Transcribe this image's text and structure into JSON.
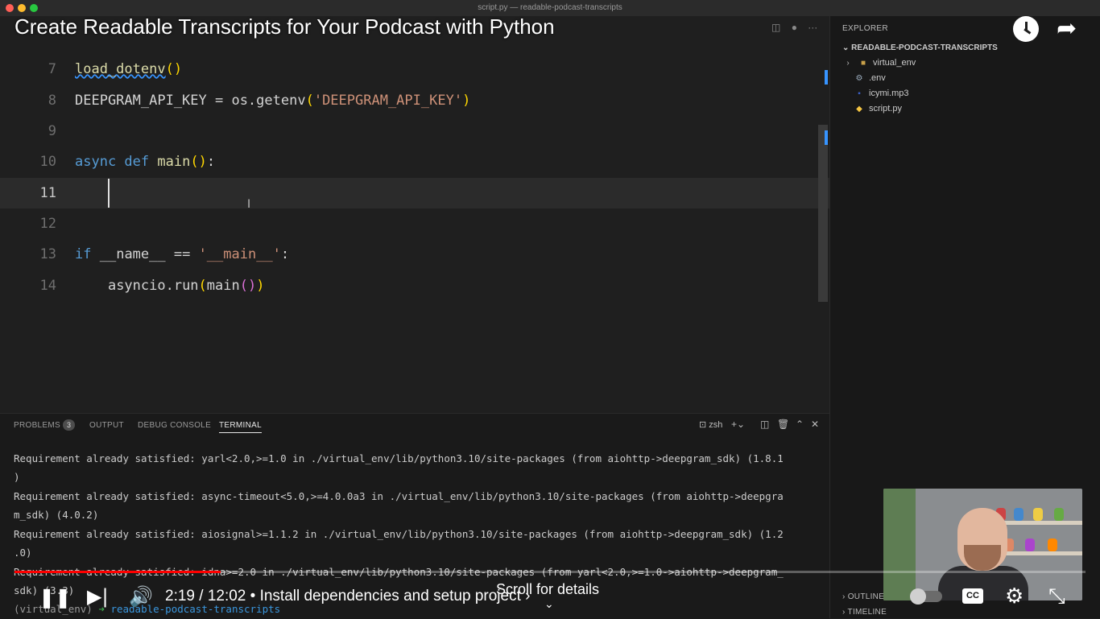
{
  "window": {
    "title": "script.py — readable-podcast-transcripts",
    "traffic_colors": [
      "#ff5f57",
      "#febc2e",
      "#28c840"
    ]
  },
  "video": {
    "title": "Create Readable Transcripts for Your Podcast with Python",
    "time": "2:19 / 12:02 • Install dependencies and setup project",
    "chapter_chevron": "›",
    "scroll_hint": "Scroll for details",
    "progress_fraction": 0.1925,
    "accent": "#ff0000"
  },
  "editor": {
    "lines": [
      {
        "n": "7"
      },
      {
        "n": "8"
      },
      {
        "n": "9"
      },
      {
        "n": "10"
      },
      {
        "n": "11"
      },
      {
        "n": "12"
      },
      {
        "n": "13"
      },
      {
        "n": "14"
      }
    ],
    "code": {
      "l7_fn": "load_dotenv",
      "l8_var": "DEEPGRAM_API_KEY = os.getenv",
      "l8_str": "'DEEPGRAM_API_KEY'",
      "l10_kw": "async def",
      "l10_fn": "main",
      "l13_kw": "if",
      "l13_mid": "__name__ == ",
      "l13_str": "'__main__'",
      "l14_pre": "asyncio.run",
      "l14_fn": "main"
    }
  },
  "sidebar": {
    "header": "EXPLORER",
    "folder": "READABLE-PODCAST-TRANSCRIPTS",
    "items": [
      {
        "label": "virtual_env",
        "icon": "folder-icon"
      },
      {
        "label": ".env",
        "icon": "gear-icon"
      },
      {
        "label": "icymi.mp3",
        "icon": "audio-file-icon"
      },
      {
        "label": "script.py",
        "icon": "python-icon"
      }
    ],
    "outline": "OUTLINE",
    "timeline": "TIMELINE"
  },
  "panel": {
    "tabs": [
      "PROBLEMS",
      "OUTPUT",
      "DEBUG CONSOLE",
      "TERMINAL"
    ],
    "problems_count": "3",
    "shell": "zsh",
    "terminal_lines": [
      "Requirement already satisfied: yarl<2.0,>=1.0 in ./virtual_env/lib/python3.10/site-packages (from aiohttp->deepgram_sdk) (1.8.1",
      ")",
      "Requirement already satisfied: async-timeout<5.0,>=4.0.0a3 in ./virtual_env/lib/python3.10/site-packages (from aiohttp->deepgra",
      "m_sdk) (4.0.2)",
      "Requirement already satisfied: aiosignal>=1.1.2 in ./virtual_env/lib/python3.10/site-packages (from aiohttp->deepgram_sdk) (1.2",
      ".0)",
      "Requirement already satisfied: idna>=2.0 in ./virtual_env/lib/python3.10/site-packages (from yarl<2.0,>=1.0->aiohttp->deepgram_",
      "sdk) (3.3)"
    ],
    "prompt_env": "(virtual_env)",
    "prompt_arrow": "➜",
    "prompt_dir": "readable-podcast-transcripts"
  }
}
